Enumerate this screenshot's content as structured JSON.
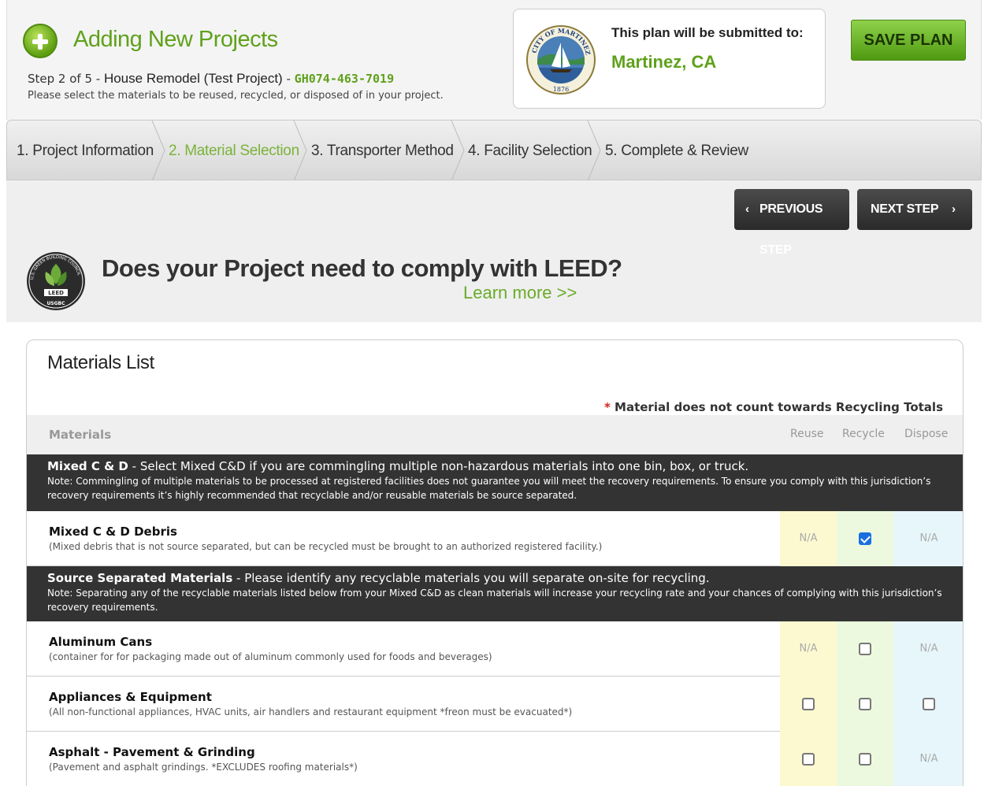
{
  "header": {
    "title": "Adding New Projects",
    "step_prefix": "Step 2 of 5 - ",
    "project_name": "House Remodel (Test Project)",
    "project_sep": " - ",
    "project_code": "GH074-463-7019",
    "hint": "Please select the materials to be reused, recycled, or disposed of in your project.",
    "submit_label": "This plan will be submitted to:",
    "submit_city": "Martinez, CA",
    "seal_top": "CITY OF MARTINEZ",
    "seal_year": "1876",
    "save_label": "SAVE PLAN"
  },
  "tabs": [
    {
      "label": "1. Project Information",
      "active": false
    },
    {
      "label": "2. Material Selection",
      "active": true
    },
    {
      "label": "3. Transporter Method",
      "active": false
    },
    {
      "label": "4. Facility Selection",
      "active": false
    },
    {
      "label": "5. Complete & Review",
      "active": false
    }
  ],
  "nav": {
    "prev_label": "PREVIOUS STEP",
    "next_label": "NEXT STEP",
    "prev_chev": "‹",
    "next_chev": "›"
  },
  "leed": {
    "question": "Does your Project need to comply with LEED?",
    "link": "Learn more >>",
    "logo_text": "U.S. GREEN BUILDING COUNCIL",
    "logo_mid": "LEED",
    "logo_bottom": "USGBC"
  },
  "materials": {
    "title": "Materials List",
    "legend_star": "*",
    "legend_text": " Material does not count towards Recycling Totals",
    "col_materials": "Materials",
    "col_reuse": "Reuse",
    "col_recycle": "Recycle",
    "col_dispose": "Dispose",
    "mixed_section": {
      "title": "Mixed C & D",
      "title_rest": " - Select Mixed C&D if you are commingling multiple non-hazardous materials into one bin, box, or truck.",
      "note": "Note: Commingling of multiple materials to be processed at registered facilities does not guarantee you will meet the recovery requirements. To ensure you comply with this jurisdiction’s recovery requirements it’s highly recommended that recyclable and/or reusable materials be source separated."
    },
    "source_section": {
      "title": "Source Separated Materials",
      "title_rest": " - Please identify any recyclable materials you will separate on-site for recycling.",
      "note": "Note: Separating any of the recyclable materials listed below from your Mixed C&D as clean materials will increase your recycling rate and your chances of complying with this jurisdiction’s recovery requirements."
    },
    "na": "N/A",
    "rows": [
      {
        "name": "Mixed C & D Debris",
        "desc": "(Mixed debris that is not source separated, but can be recycled must be brought to an authorized registered facility.)",
        "reuse": "na",
        "recycle": "checked",
        "dispose": "na"
      },
      {
        "name": "Aluminum Cans",
        "desc": "(container for for packaging made out of aluminum commonly used for foods and beverages)",
        "reuse": "na",
        "recycle": "unchecked",
        "dispose": "na"
      },
      {
        "name": "Appliances & Equipment",
        "desc": "(All non-functional appliances, HVAC units, air handlers and restaurant equipment *freon must be evacuated*)",
        "reuse": "unchecked",
        "recycle": "unchecked",
        "dispose": "unchecked"
      },
      {
        "name": "Asphalt - Pavement & Grinding",
        "desc": "(Pavement and asphalt grindings. *EXCLUDES roofing materials*)",
        "reuse": "unchecked",
        "recycle": "unchecked",
        "dispose": "na"
      }
    ]
  },
  "colors": {
    "brand_green": "#5fa11b",
    "active_tab": "#7ab339",
    "dark_bar": "#333333",
    "reuse_bg": "#fcf9d0",
    "recycle_bg": "#ecf9de",
    "dispose_bg": "#e6f6fb"
  }
}
